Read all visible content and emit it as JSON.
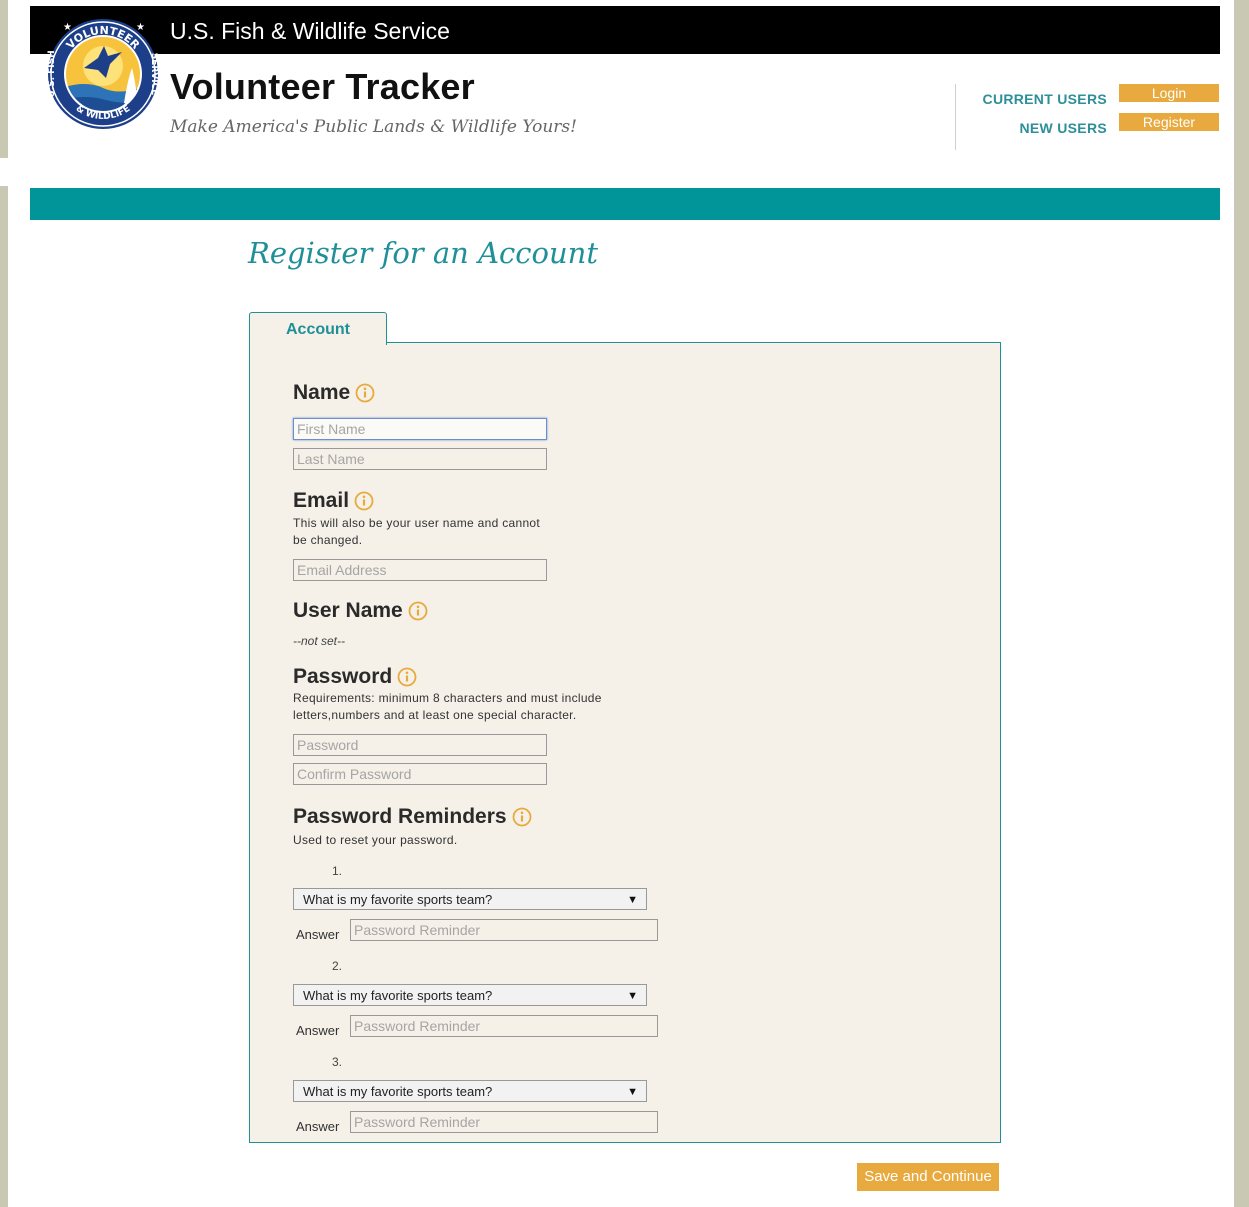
{
  "header": {
    "agency": "U.S. Fish & Wildlife Service",
    "app_title": "Volunteer Tracker",
    "tagline": "Make America's Public Lands & Wildlife Yours!",
    "logo_text_top": "VOLUNTEER",
    "logo_text_left": "U.S. FISH",
    "logo_text_bottom": "& WILDLIFE",
    "logo_text_right": "SERVICE",
    "current_users_label": "CURRENT USERS",
    "new_users_label": "NEW USERS",
    "login_label": "Login",
    "register_label": "Register"
  },
  "page": {
    "title": "Register for an Account",
    "tab_label": "Account"
  },
  "form": {
    "name": {
      "title": "Name",
      "first_placeholder": "First Name",
      "last_placeholder": "Last Name"
    },
    "email": {
      "title": "Email",
      "description": "This will also be your user name and cannot be changed.",
      "placeholder": "Email Address"
    },
    "username": {
      "title": "User Name",
      "value": "--not set--"
    },
    "password": {
      "title": "Password",
      "description": "Requirements: minimum 8 characters and must include letters,numbers and at least one special character.",
      "placeholder": "Password",
      "confirm_placeholder": "Confirm Password"
    },
    "reminders": {
      "title": "Password Reminders",
      "description": "Used to reset your password.",
      "answer_label": "Answer",
      "items": [
        {
          "number": "1.",
          "question": "What is my favorite sports team?",
          "placeholder": "Password Reminder"
        },
        {
          "number": "2.",
          "question": "What is my favorite sports team?",
          "placeholder": "Password Reminder"
        },
        {
          "number": "3.",
          "question": "What is my favorite sports team?",
          "placeholder": "Password Reminder"
        }
      ]
    },
    "save_label": "Save and Continue"
  },
  "colors": {
    "teal": "#01959a",
    "accent_text": "#1f8f98",
    "orange": "#e8a93e",
    "panel_bg": "#f5f1e8",
    "topbar": "#000000"
  }
}
